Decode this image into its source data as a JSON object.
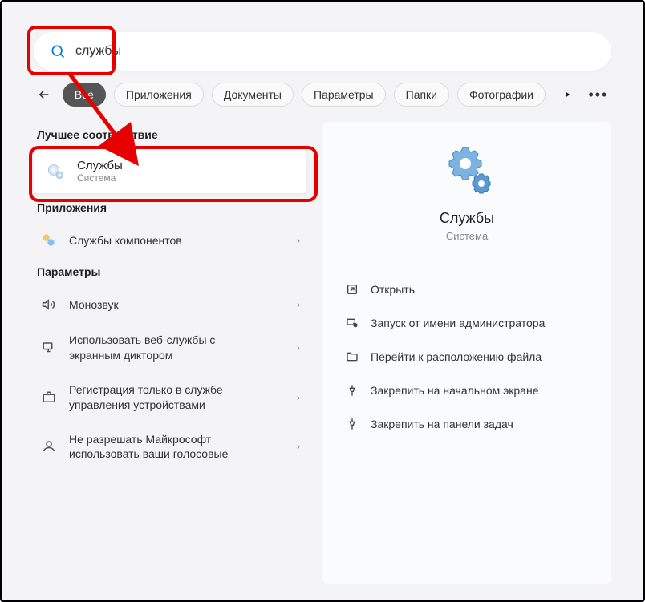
{
  "search": {
    "value": "службы"
  },
  "filters": {
    "all": "Все",
    "apps": "Приложения",
    "docs": "Документы",
    "params": "Параметры",
    "folders": "Папки",
    "photos": "Фотографии"
  },
  "sections": {
    "best_match": "Лучшее соответствие",
    "apps": "Приложения",
    "params": "Параметры"
  },
  "best_match": {
    "title": "Службы",
    "subtitle": "Система"
  },
  "app_results": [
    {
      "label": "Службы компонентов"
    }
  ],
  "param_results": [
    {
      "label": "Монозвук"
    },
    {
      "label": "Использовать веб-службы с экранным диктором"
    },
    {
      "label": "Регистрация только в службе управления устройствами"
    },
    {
      "label": "Не разрешать Майкрософт использовать ваши голосовые"
    }
  ],
  "preview": {
    "title": "Службы",
    "subtitle": "Система"
  },
  "actions": [
    {
      "icon": "open",
      "label": "Открыть"
    },
    {
      "icon": "admin",
      "label": "Запуск от имени администратора"
    },
    {
      "icon": "folder",
      "label": "Перейти к расположению файла"
    },
    {
      "icon": "pin",
      "label": "Закрепить на начальном экране"
    },
    {
      "icon": "pin",
      "label": "Закрепить на панели задач"
    }
  ]
}
